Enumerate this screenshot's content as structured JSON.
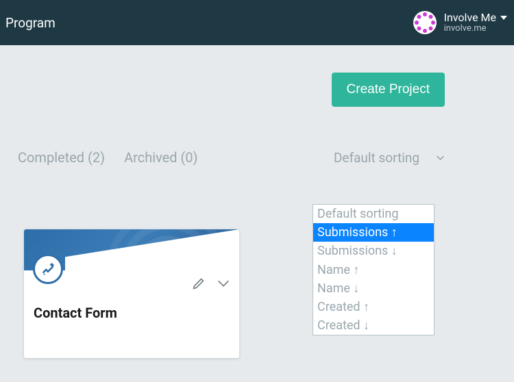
{
  "header": {
    "title": "Program",
    "user": {
      "name": "Involve Me",
      "subtitle": "involve.me"
    }
  },
  "actions": {
    "create_label": "Create Project"
  },
  "tabs": {
    "completed_label": "Completed (2)",
    "archived_label": "Archived (0)"
  },
  "sort": {
    "current": "Default sorting",
    "options": [
      "Default sorting",
      "Submissions ↑",
      "Submissions ↓",
      "Name ↑",
      "Name ↓",
      "Created ↑",
      "Created ↓"
    ],
    "selected_index": 1
  },
  "project_card": {
    "title": "Contact Form"
  },
  "colors": {
    "accent": "#2fb59b",
    "topbar": "#1f3944",
    "card_brand": "#2d6ea8",
    "selection": "#0a84ff"
  }
}
